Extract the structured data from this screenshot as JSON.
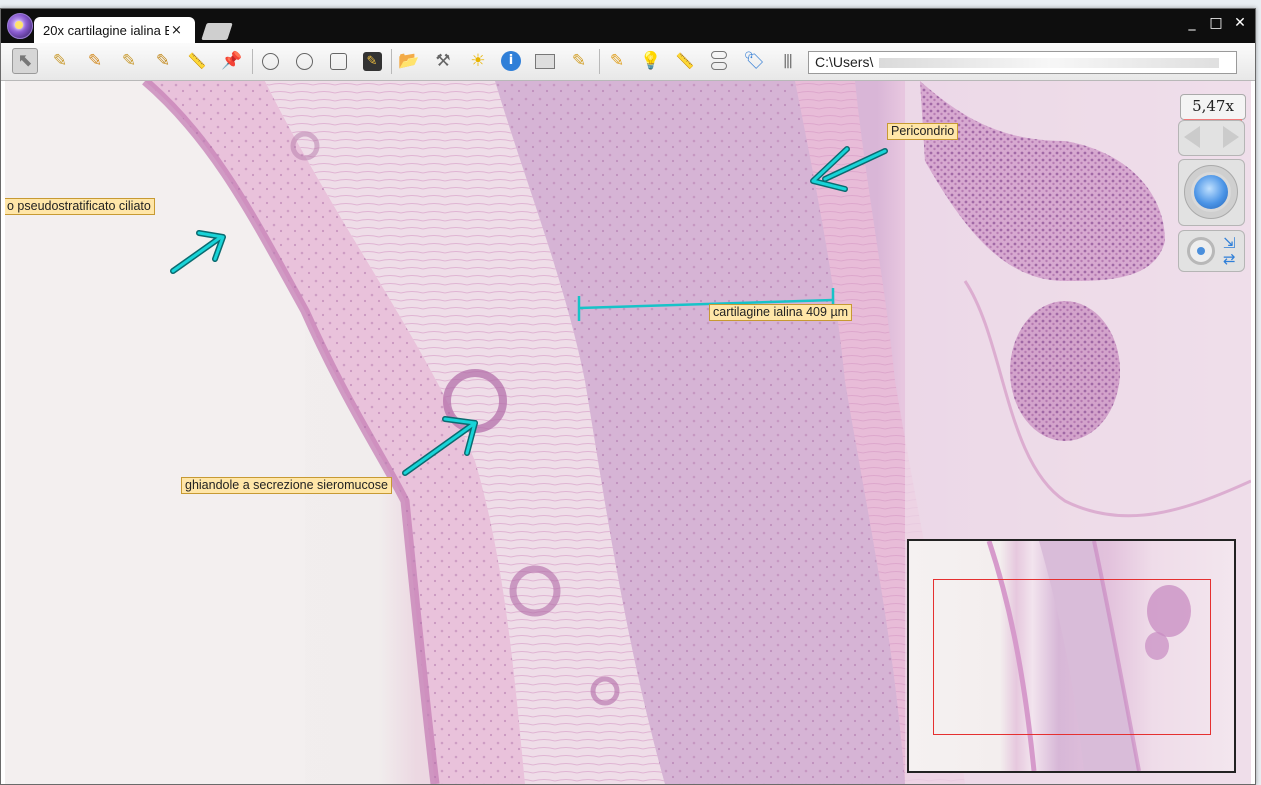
{
  "titlebar": {
    "tab_label": "20x cartilagine ialina E",
    "tab_close": "×",
    "controls": {
      "minimize": "_",
      "maximize": "□",
      "close": "✕"
    }
  },
  "toolbar": {
    "tools": [
      {
        "name": "select-tool",
        "icon": "pointer-icon"
      },
      {
        "name": "pencil-tool-1",
        "icon": "pencil-icon"
      },
      {
        "name": "pencil-tool-2",
        "icon": "pencil-icon"
      },
      {
        "name": "pencil-tool-3",
        "icon": "pencil-icon"
      },
      {
        "name": "pencil-tool-4",
        "icon": "pencil-icon"
      },
      {
        "name": "ruler-tool",
        "icon": "ruler-icon"
      },
      {
        "name": "pin-tool",
        "icon": "pin-icon"
      },
      {
        "name": "circle-tool-1",
        "icon": "circle-icon"
      },
      {
        "name": "circle-tool-2",
        "icon": "circle-icon"
      },
      {
        "name": "rectangle-tool",
        "icon": "rectangle-icon"
      },
      {
        "name": "note-tool",
        "icon": "note-pencil-icon"
      },
      {
        "name": "open-folder",
        "icon": "folder-icon"
      },
      {
        "name": "tools-settings",
        "icon": "wrench-icon"
      },
      {
        "name": "brightness",
        "icon": "sun-icon"
      },
      {
        "name": "info",
        "icon": "info-icon"
      },
      {
        "name": "slide-label",
        "icon": "image-icon"
      },
      {
        "name": "annotation-pencil",
        "icon": "pencil-icon"
      },
      {
        "name": "draw-pencil",
        "icon": "pencil-icon"
      },
      {
        "name": "marker",
        "icon": "lightbulb-icon"
      },
      {
        "name": "measure-ruler",
        "icon": "ruler-icon"
      },
      {
        "name": "layers",
        "icon": "layers-icon"
      },
      {
        "name": "tag",
        "icon": "tag-icon"
      },
      {
        "name": "barcode",
        "icon": "barcode-icon"
      }
    ],
    "path_value": "C:\\Users\\"
  },
  "annotations": {
    "epithelium": "o pseudostratificato ciliato",
    "pericondrio": "Pericondrio",
    "measurement": "cartilagine ialina 409 µm",
    "glands": "ghiandole a secrezione sieromucose"
  },
  "navigator": {
    "zoom": "5,47x"
  },
  "colors": {
    "annotation_cyan": "#00c8cc",
    "label_bg": "#ffe6a8",
    "minimap_frame": "#e53030"
  }
}
